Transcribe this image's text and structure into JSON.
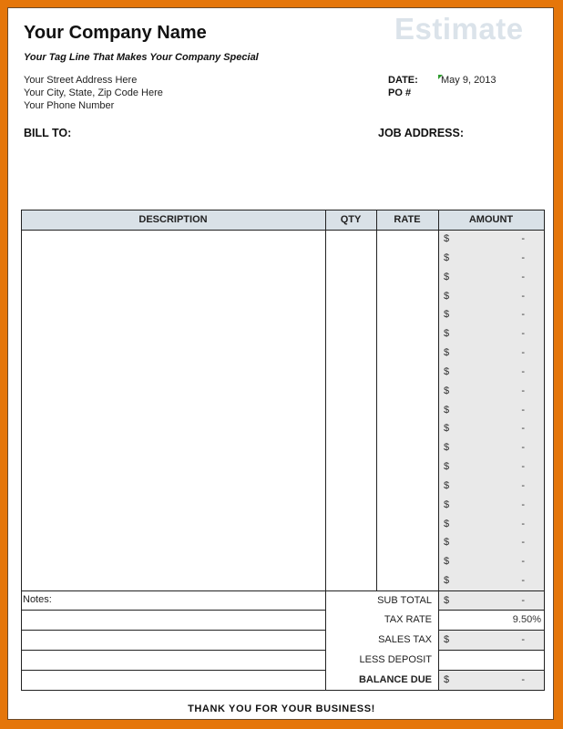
{
  "company": {
    "name": "Your Company Name",
    "tagline": "Your Tag Line That Makes Your Company Special",
    "address_lines": [
      "Your Street Address Here",
      "Your City, State, Zip Code Here",
      "Your Phone Number"
    ]
  },
  "document_title": "Estimate",
  "meta": {
    "date_label": "DATE:",
    "date_value": "May 9, 2013",
    "po_label": "PO #",
    "po_value": ""
  },
  "bill_to_label": "BILL TO:",
  "job_address_label": "JOB ADDRESS:",
  "table": {
    "headers": {
      "description": "DESCRIPTION",
      "qty": "QTY",
      "rate": "RATE",
      "amount": "AMOUNT"
    },
    "line_items": [
      {
        "description": "",
        "qty": "",
        "rate": "",
        "currency": "$",
        "amount": "-"
      },
      {
        "description": "",
        "qty": "",
        "rate": "",
        "currency": "$",
        "amount": "-"
      },
      {
        "description": "",
        "qty": "",
        "rate": "",
        "currency": "$",
        "amount": "-"
      },
      {
        "description": "",
        "qty": "",
        "rate": "",
        "currency": "$",
        "amount": "-"
      },
      {
        "description": "",
        "qty": "",
        "rate": "",
        "currency": "$",
        "amount": "-"
      },
      {
        "description": "",
        "qty": "",
        "rate": "",
        "currency": "$",
        "amount": "-"
      },
      {
        "description": "",
        "qty": "",
        "rate": "",
        "currency": "$",
        "amount": "-"
      },
      {
        "description": "",
        "qty": "",
        "rate": "",
        "currency": "$",
        "amount": "-"
      },
      {
        "description": "",
        "qty": "",
        "rate": "",
        "currency": "$",
        "amount": "-"
      },
      {
        "description": "",
        "qty": "",
        "rate": "",
        "currency": "$",
        "amount": "-"
      },
      {
        "description": "",
        "qty": "",
        "rate": "",
        "currency": "$",
        "amount": "-"
      },
      {
        "description": "",
        "qty": "",
        "rate": "",
        "currency": "$",
        "amount": "-"
      },
      {
        "description": "",
        "qty": "",
        "rate": "",
        "currency": "$",
        "amount": "-"
      },
      {
        "description": "",
        "qty": "",
        "rate": "",
        "currency": "$",
        "amount": "-"
      },
      {
        "description": "",
        "qty": "",
        "rate": "",
        "currency": "$",
        "amount": "-"
      },
      {
        "description": "",
        "qty": "",
        "rate": "",
        "currency": "$",
        "amount": "-"
      },
      {
        "description": "",
        "qty": "",
        "rate": "",
        "currency": "$",
        "amount": "-"
      },
      {
        "description": "",
        "qty": "",
        "rate": "",
        "currency": "$",
        "amount": "-"
      },
      {
        "description": "",
        "qty": "",
        "rate": "",
        "currency": "$",
        "amount": "-"
      }
    ]
  },
  "notes_label": "Notes:",
  "summary": [
    {
      "label": "SUB TOTAL",
      "currency": "$",
      "value": "-",
      "shaded": true,
      "bold": false
    },
    {
      "label": "TAX RATE",
      "currency": "",
      "value": "9.50%",
      "shaded": false,
      "bold": false
    },
    {
      "label": "SALES TAX",
      "currency": "$",
      "value": "-",
      "shaded": true,
      "bold": false
    },
    {
      "label": "LESS DEPOSIT",
      "currency": "",
      "value": "",
      "shaded": false,
      "bold": false
    },
    {
      "label": "BALANCE DUE",
      "currency": "$",
      "value": "-",
      "shaded": true,
      "bold": true
    }
  ],
  "footer_message": "THANK YOU FOR YOUR BUSINESS!",
  "colors": {
    "frame": "#e5760a",
    "header_fill": "#d9e1e7",
    "amount_fill": "#e9e9e9",
    "title_watermark": "#dbe3ea"
  }
}
